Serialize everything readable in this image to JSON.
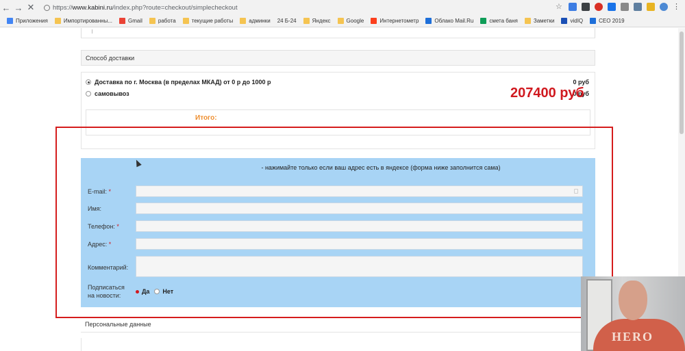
{
  "browser": {
    "url_prefix": "https://",
    "url_host": "www.kabini.ru",
    "url_path": "/index.php?route=checkout/simplecheckout",
    "bookmarks": [
      "Приложения",
      "Импортированны...",
      "Gmail",
      "работа",
      "текущие работы",
      "админки",
      "24 Б-24",
      "Яндекс",
      "Google",
      "Интернетометр",
      "Облако Mail.Ru",
      "смета баня",
      "Заметки",
      "vidIQ",
      "СЕО 2019"
    ]
  },
  "delivery": {
    "header": "Способ доставки",
    "options": [
      {
        "label": "Доставка по г. Москва (в пределах МКАД) от 0 р до 1000 р",
        "price": "0 руб",
        "selected": true
      },
      {
        "label": "самовывоз",
        "price": "0 руб",
        "selected": false
      }
    ],
    "total_label": "Итого:",
    "total_value": "207400 руб"
  },
  "form": {
    "hint": "- нажимайте только если ваш адрес есть в яндексе (форма ниже заполнится сама)",
    "fields": [
      {
        "label": "E-mail:",
        "required": "*",
        "value": ""
      },
      {
        "label": "Имя:",
        "required": "",
        "value": ""
      },
      {
        "label": "Телефон:",
        "required": "*",
        "value": ""
      },
      {
        "label": "Адрес:",
        "required": "*",
        "value": ""
      },
      {
        "label": "Комментарий:",
        "required": "",
        "value": ""
      }
    ],
    "subscribe_label_1": "Подписаться",
    "subscribe_label_2": "на новости:",
    "subscribe_yes": "Да",
    "subscribe_no": "Нет"
  },
  "personal": {
    "header": "Персональные данные"
  },
  "webcam": {
    "shirt_text": "HERO"
  },
  "colors": {
    "accent_red": "#d0191f",
    "form_bg": "#a8d4f5",
    "total_orange": "#ee8d2d"
  }
}
